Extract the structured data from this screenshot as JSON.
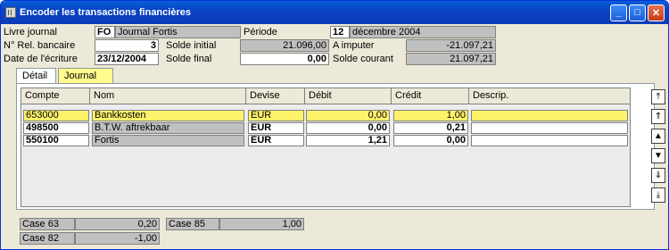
{
  "window": {
    "title": "Encoder les transactions financières",
    "buttons": [
      "_",
      "□",
      "✕"
    ]
  },
  "header": {
    "journal_label": "Livre journal",
    "journal_code": "FO",
    "journal_name": "Journal Fortis",
    "period_label": "Période",
    "period_num": "12",
    "period_name": "décembre 2004",
    "bank_rel_label": "N° Rel. bancaire",
    "bank_rel_value": "3",
    "opening_label": "Solde initial",
    "opening_value": "21.096,00",
    "to_assign_label": "A imputer",
    "to_assign_value": "-21.097,21",
    "date_label": "Date de l'écriture",
    "date_value": "23/12/2004",
    "final_label": "Solde final",
    "final_value": "0,00",
    "current_label": "Solde courant",
    "current_value": "21.097,21"
  },
  "tabs": [
    {
      "label": "Détail"
    },
    {
      "label": "Journal"
    }
  ],
  "table": {
    "columns": [
      "Compte",
      "Nom",
      "Devise",
      "Débit",
      "Crédit",
      "Descrip."
    ],
    "rows": [
      {
        "compte": "653000",
        "nom": "Bankkosten",
        "devise": "EUR",
        "debit": "0,00",
        "credit": "1,00",
        "descrip": ""
      },
      {
        "compte": "498500",
        "nom": "B.T.W. aftrekbaar",
        "devise": "EUR",
        "debit": "0,00",
        "credit": "0,21",
        "descrip": ""
      },
      {
        "compte": "550100",
        "nom": "Fortis",
        "devise": "EUR",
        "debit": "1,21",
        "credit": "0,00",
        "descrip": ""
      }
    ]
  },
  "nav": [
    "first-icon",
    "page-up-icon",
    "up-icon",
    "down-icon",
    "page-down-icon",
    "last-icon"
  ],
  "cases": [
    {
      "label": "Case 63",
      "value": "0,20"
    },
    {
      "label": "Case 85",
      "value": "1,00"
    },
    {
      "label": "Case 82",
      "value": "-1,00"
    }
  ]
}
